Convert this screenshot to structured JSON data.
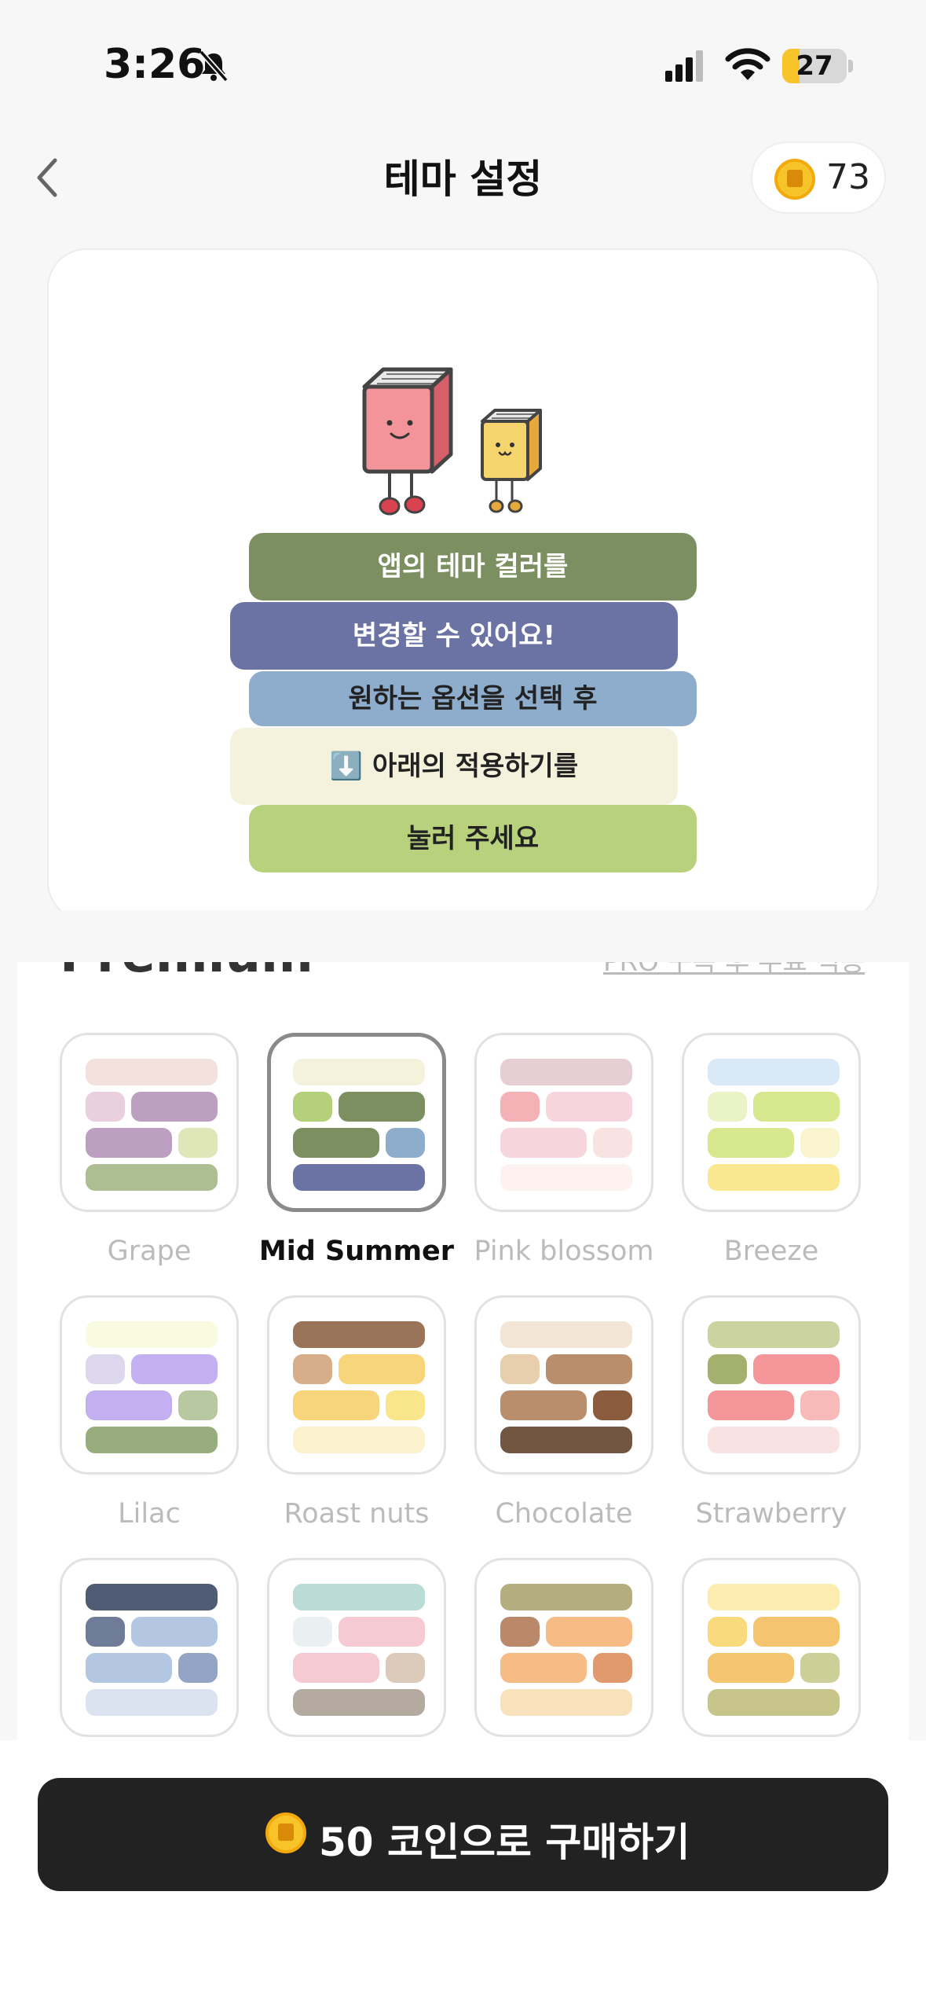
{
  "status_bar": {
    "time": "3:26",
    "battery": "27",
    "battery_level": 0.27
  },
  "header": {
    "title": "테마 설정",
    "coins": "73"
  },
  "preview": {
    "lines": [
      {
        "text": "앱의 테마 컬러를",
        "bg": "#7b8f60",
        "fg": "#ffffff"
      },
      {
        "text": "변경할 수 있어요!",
        "bg": "#6a73a4",
        "fg": "#ffffff"
      },
      {
        "text": "원하는 옵션을 선택 후",
        "bg": "#8eaccb",
        "fg": "#222222"
      },
      {
        "text": "⬇️ 아래의 적용하기를",
        "bg": "#f4f1dc",
        "fg": "#222222"
      },
      {
        "text": "눌러 주세요",
        "bg": "#b8d17c",
        "fg": "#222222"
      }
    ]
  },
  "premium": {
    "title": "Premium",
    "link": "PRO 구독 후 무료 적용"
  },
  "themes": [
    {
      "name": "Grape",
      "selected": false,
      "colors": [
        "#f3e1dd",
        "#e9d0de",
        "#bd9fc2",
        "#bd9fc2",
        "#dfe7b9",
        "#adbf92"
      ]
    },
    {
      "name": "Mid Summer",
      "selected": true,
      "colors": [
        "#f4f1dc",
        "#b4d07a",
        "#7b8f60",
        "#7b8f60",
        "#8eaccb",
        "#6a73a4"
      ]
    },
    {
      "name": "Pink blossom",
      "selected": false,
      "colors": [
        "#e5cfd3",
        "#f4b2b6",
        "#f6d6dc",
        "#f6d6dc",
        "#f9e2e2",
        "#fdf2ef"
      ]
    },
    {
      "name": "Breeze",
      "selected": false,
      "colors": [
        "#d9e9f8",
        "#eaf3c6",
        "#d7e88f",
        "#d7e88f",
        "#fbf5cf",
        "#f9e88f"
      ]
    },
    {
      "name": "Lilac",
      "selected": false,
      "colors": [
        "#f9fbe1",
        "#dcd7ec",
        "#c3aff2",
        "#c3aff2",
        "#b8c8a0",
        "#98ad7d"
      ]
    },
    {
      "name": "Roast nuts",
      "selected": false,
      "colors": [
        "#9a7459",
        "#d7ae8a",
        "#f8d57a",
        "#f8d57a",
        "#f9e68a",
        "#fcf2cd"
      ]
    },
    {
      "name": "Chocolate",
      "selected": false,
      "colors": [
        "#f4e6d7",
        "#e7cfae",
        "#b88e6d",
        "#b88e6d",
        "#8a5b3c",
        "#735641"
      ]
    },
    {
      "name": "Strawberry",
      "selected": false,
      "colors": [
        "#cbd4a1",
        "#a4b06d",
        "#f5969a",
        "#f5969a",
        "#f9baba",
        "#f9e2e2"
      ]
    },
    {
      "name": "",
      "selected": false,
      "colors": [
        "#4e5b72",
        "#6e7c99",
        "#b3c6e2",
        "#b3c6e2",
        "#93a4c5",
        "#dbe3f1"
      ]
    },
    {
      "name": "",
      "selected": false,
      "colors": [
        "#bbdbd6",
        "#eaf0f1",
        "#f5cad3",
        "#f5cad3",
        "#dccbbb",
        "#b5aaa0"
      ]
    },
    {
      "name": "",
      "selected": false,
      "colors": [
        "#b3ad7f",
        "#b9896a",
        "#f7bb86",
        "#f7bb86",
        "#e19a6e",
        "#f7e2bc"
      ]
    },
    {
      "name": "",
      "selected": false,
      "colors": [
        "#fcecaf",
        "#f8d97b",
        "#f5c46f",
        "#f5c46f",
        "#cccf98",
        "#c8c58a"
      ]
    }
  ],
  "footer": {
    "buy_label": "50 코인으로 구매하기"
  }
}
